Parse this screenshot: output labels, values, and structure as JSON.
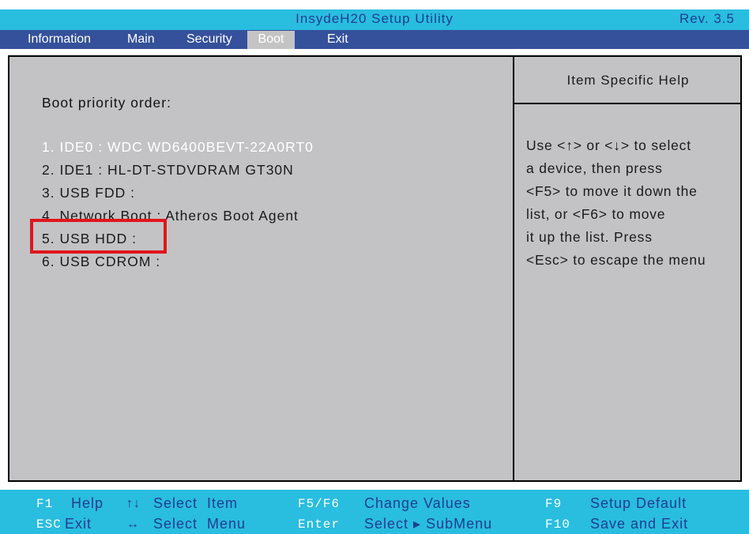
{
  "window": {
    "title": "InsydeH20 Setup Utility",
    "revision": "Rev. 3.5"
  },
  "menu": [
    {
      "label": "Information"
    },
    {
      "label": "Main"
    },
    {
      "label": "Security"
    },
    {
      "label": "Boot",
      "active": true
    },
    {
      "label": "Exit"
    }
  ],
  "main": {
    "heading": "Boot priority order:",
    "boot_items": [
      {
        "label": "1. IDE0 : WDC WD6400BEVT-22A0RT0",
        "selected": true
      },
      {
        "label": "2. IDE1 : HL-DT-STDVDRAM GT30N"
      },
      {
        "label": "3. USB FDD :"
      },
      {
        "label": "4. Network Boot : Atheros Boot Agent"
      },
      {
        "label": "5. USB HDD :"
      },
      {
        "label": "6. USB CDROM :"
      }
    ]
  },
  "help": {
    "title": "Item Specific Help",
    "lines": [
      "Use <↑> or <↓> to select",
      "a device, then press",
      "<F5> to move it down the",
      "list, or <F6> to move",
      "it up the list. Press",
      "<Esc> to escape the menu"
    ]
  },
  "footer": {
    "row1": [
      {
        "key": "F1",
        "desc": "Help"
      },
      {
        "icon": "↑↓",
        "desc": "Select  Item"
      },
      {
        "key": "F5/F6",
        "desc": "Change Values"
      },
      {
        "key": "F9",
        "desc": "Setup Default"
      }
    ],
    "row2": [
      {
        "key": "ESC",
        "desc": "Exit"
      },
      {
        "icon": "↔",
        "desc": "Select  Menu"
      },
      {
        "key": "Enter",
        "desc": "Select ▸ SubMenu"
      },
      {
        "key": "F10",
        "desc": "Save and Exit"
      }
    ]
  },
  "colors": {
    "header_bg": "#29bde0",
    "menu_bg": "#35519c",
    "panel_bg": "#c3c3c5",
    "highlight": "#e0161b"
  }
}
